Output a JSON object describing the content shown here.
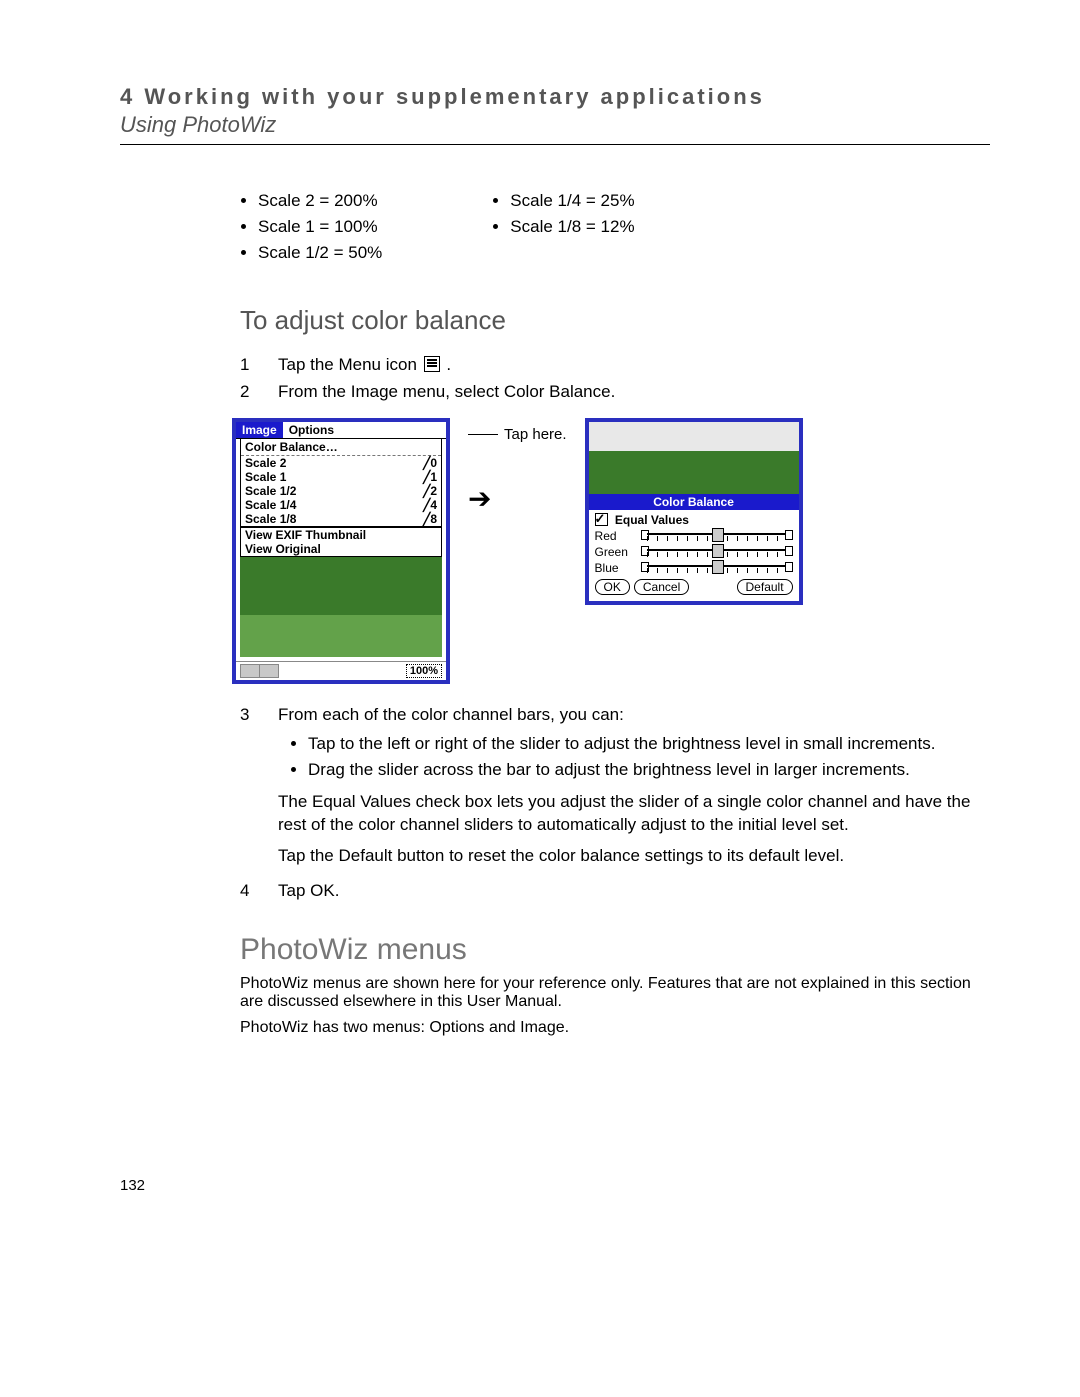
{
  "header": {
    "chapter_line": "4 Working with your supplementary applications",
    "section": "Using PhotoWiz"
  },
  "scales": {
    "col1": [
      "Scale 2 = 200%",
      "Scale 1 = 100%",
      "Scale 1/2 = 50%"
    ],
    "col2": [
      "Scale 1/4 = 25%",
      "Scale 1/8 = 12%"
    ]
  },
  "adjust_heading": "To adjust color balance",
  "step1_pre": "Tap the Menu icon ",
  "step1_post": ".",
  "step2": "From the Image menu, select Color Balance.",
  "callout": "Tap here.",
  "menu": {
    "tab_image": "Image",
    "tab_options": "Options",
    "group_title": "Color Balance…",
    "rows": [
      {
        "l": "Scale 2",
        "r": "╱0"
      },
      {
        "l": "Scale 1",
        "r": "╱1"
      },
      {
        "l": "Scale 1/2",
        "r": "╱2"
      },
      {
        "l": "Scale 1/4",
        "r": "╱4"
      },
      {
        "l": "Scale 1/8",
        "r": "╱8"
      }
    ],
    "foot1": "View EXIF Thumbnail",
    "foot2": "View Original",
    "zoom": "100%"
  },
  "dialog": {
    "title": "Color Balance",
    "equal": "Equal Values",
    "channels": [
      "Red",
      "Green",
      "Blue"
    ],
    "ok": "OK",
    "cancel": "Cancel",
    "default": "Default"
  },
  "step3_lead": "From each of the color channel bars, you can:",
  "step3_b1": "Tap to the left or right of the slider to adjust the brightness level in small increments.",
  "step3_b2": "Drag the slider across the bar to adjust the brightness level in larger increments.",
  "step3_p1": "The Equal Values check box lets you adjust the slider of a single color channel and have the rest of the color channel sliders to automatically adjust to the initial level set.",
  "step3_p2": "Tap the Default button to reset the color balance settings to its default level.",
  "step4": "Tap OK.",
  "menus_heading": "PhotoWiz menus",
  "menus_p1": "PhotoWiz menus are shown here for your reference only. Features that are not explained in this section are discussed elsewhere in this User Manual.",
  "menus_p2": "PhotoWiz has two menus: Options and Image.",
  "page_number": "132"
}
